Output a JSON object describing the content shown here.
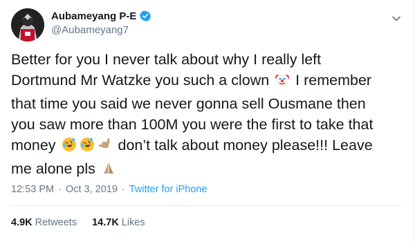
{
  "author": {
    "display_name": "Aubameyang P-E",
    "handle": "@Aubameyang7",
    "verified_icon": "verified-badge-icon",
    "verified_color": "#1da1f2"
  },
  "tweet": {
    "line1": "Better for you I never talk about why I really left",
    "line2a": "Dortmund Mr Watzke you such a clown",
    "line2b": "I remember",
    "line3": "that time you said we never gonna sell Ousmane then",
    "line4": "you saw more than 100M you were the first to take that",
    "line5a": "money",
    "line5b": "don’t talk about money please!!! Leave",
    "line6": "me alone pls"
  },
  "meta": {
    "time": "12:53 PM",
    "date": "Oct 3, 2019",
    "separator": "·",
    "client": "Twitter for iPhone"
  },
  "stats": {
    "retweets_count": "4.9K",
    "retweets_label": "Retweets",
    "likes_count": "14.7K",
    "likes_label": "Likes"
  },
  "colors": {
    "text": "#14171a",
    "secondary": "#657786",
    "link": "#1da1f2",
    "divider": "#e6ecf0"
  },
  "icons": [
    "clown-face-icon",
    "rolling-on-floor-laughing-icon",
    "call-me-hand-icon",
    "folded-hands-icon",
    "chevron-down-icon"
  ]
}
